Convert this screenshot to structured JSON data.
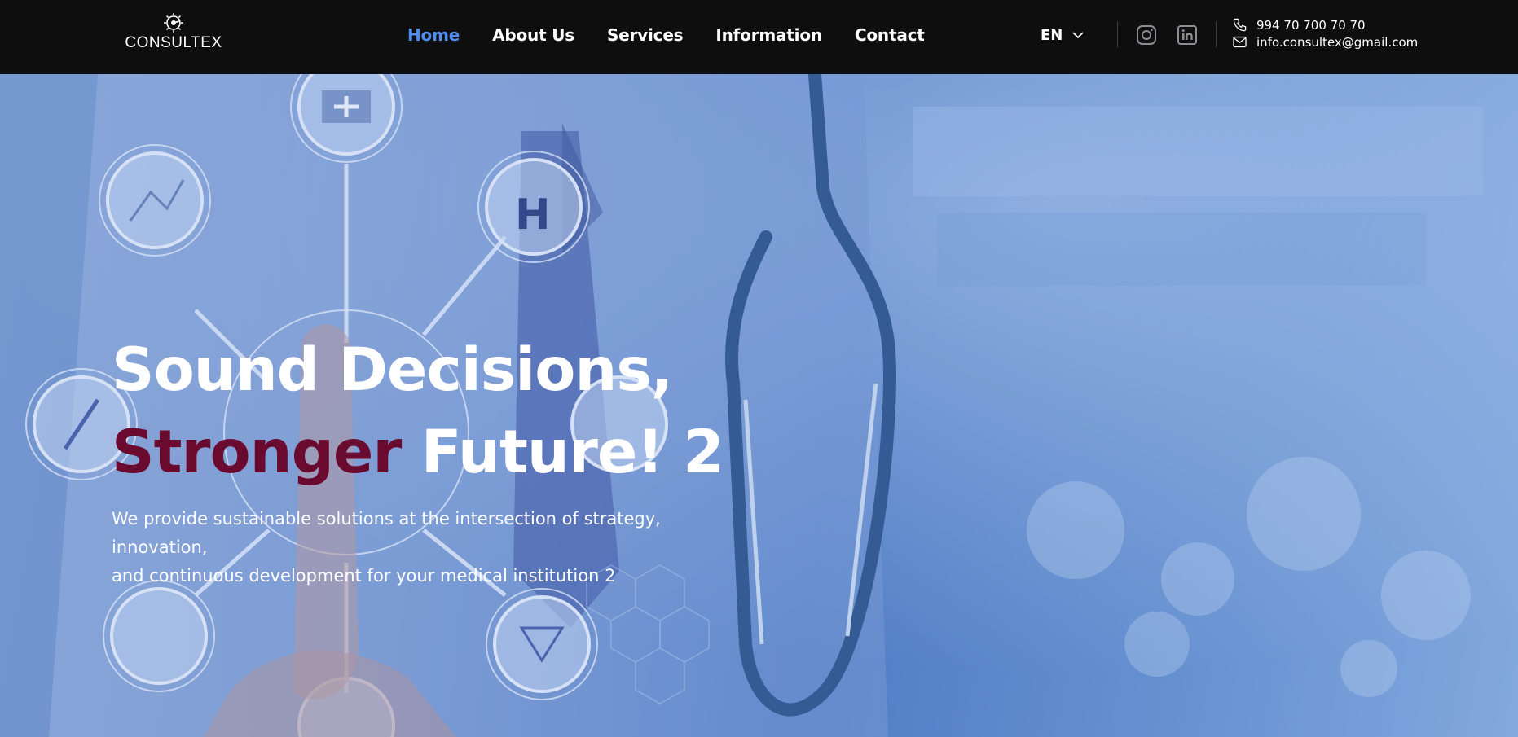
{
  "brand": {
    "name": "CONSULTEX",
    "logo_icon": "compass-sun-emblem"
  },
  "nav": {
    "items": [
      {
        "label": "Home",
        "active": true
      },
      {
        "label": "About Us",
        "active": false
      },
      {
        "label": "Services",
        "active": false
      },
      {
        "label": "Information",
        "active": false
      },
      {
        "label": "Contact",
        "active": false
      }
    ]
  },
  "language": {
    "selected": "EN",
    "icon": "chevron-down-icon"
  },
  "social": [
    {
      "name": "instagram-icon"
    },
    {
      "name": "linkedin-icon"
    }
  ],
  "contact": {
    "phone": "994 70 700 70 70",
    "email": "info.consultex@gmail.com",
    "phone_icon": "phone-icon",
    "email_icon": "envelope-icon"
  },
  "hero": {
    "headline_line1": "Sound Decisions,",
    "headline_accent": "Stronger",
    "headline_rest": "Future! 2",
    "subtext_line1": "We provide sustainable solutions at the intersection of strategy, innovation,",
    "subtext_line2": "and continuous development for your medical institution 2",
    "background_image": "doctor with stethoscope and medical icon network, blue tint"
  },
  "colors": {
    "topbar": "#0e0e0f",
    "nav_active": "#4f8df0",
    "accent": "#6b0a2f",
    "hero_tint": "#5a82c8"
  }
}
